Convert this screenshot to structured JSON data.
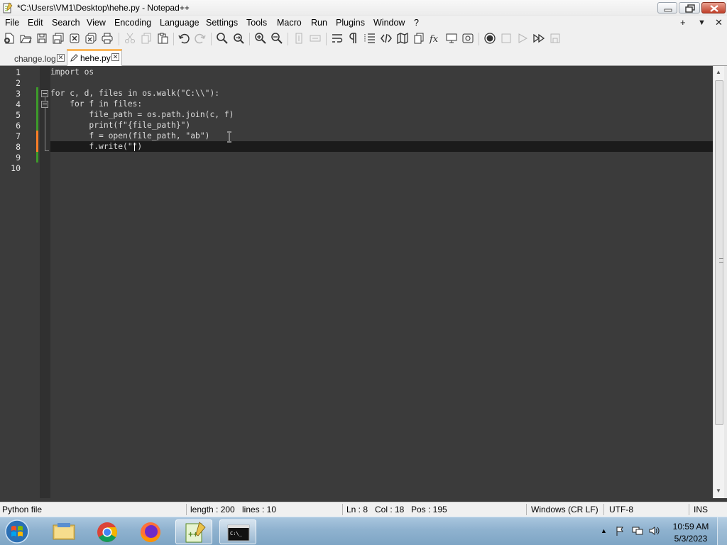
{
  "window": {
    "title": "*C:\\Users\\VM1\\Desktop\\hehe.py - Notepad++"
  },
  "menubar": {
    "items": [
      "File",
      "Edit",
      "Search",
      "View",
      "Encoding",
      "Language",
      "Settings",
      "Tools",
      "Macro",
      "Run",
      "Plugins",
      "Window",
      "?"
    ],
    "right": [
      "+",
      "▼",
      "✕"
    ]
  },
  "toolbar": {
    "icons": [
      "new-file-icon",
      "open-file-icon",
      "save-icon",
      "save-all-icon",
      "close-icon",
      "close-all-icon",
      "print-icon",
      "cut-icon",
      "copy-icon",
      "paste-icon",
      "undo-icon",
      "redo-icon",
      "find-icon",
      "replace-icon",
      "zoom-in-icon",
      "zoom-out-icon",
      "sync-vertical-icon",
      "sync-horizontal-icon",
      "word-wrap-icon",
      "show-all-characters-icon",
      "indent-guide-icon",
      "xml-tag-icon",
      "document-map-icon",
      "doc-list-icon",
      "function-list-icon",
      "folder-workspace-icon",
      "monitoring-icon",
      "record-macro-icon",
      "stop-record-icon",
      "play-macro-icon",
      "run-macro-multiple-icon",
      "save-macro-icon"
    ]
  },
  "tabs": [
    {
      "label": "change.log",
      "active": false
    },
    {
      "label": "hehe.py",
      "active": true
    }
  ],
  "editor": {
    "line_numbers": [
      "1",
      "2",
      "3",
      "4",
      "5",
      "6",
      "7",
      "8",
      "9",
      "10"
    ],
    "lines": [
      "import os",
      "",
      "for c, d, files in os.walk(\"C:\\\\\"):",
      "    for f in files:",
      "        file_path = os.path.join(c, f)",
      "        print(f\"{file_path}\")",
      "        f = open(file_path, \"ab\")",
      "        f.write(\"\")",
      "",
      ""
    ],
    "current_line": 8
  },
  "statusbar": {
    "file_type": "Python file",
    "length": "length : 200",
    "lines": "lines : 10",
    "ln": "Ln : 8",
    "col": "Col : 18",
    "pos": "Pos : 195",
    "eol": "Windows (CR LF)",
    "encoding": "UTF-8",
    "mode": "INS"
  },
  "taskbar": {
    "apps": [
      "start-orb",
      "file-explorer",
      "chrome",
      "firefox",
      "notepad-plus-plus",
      "command-prompt"
    ],
    "time": "10:59 AM",
    "date": "5/3/2023"
  }
}
